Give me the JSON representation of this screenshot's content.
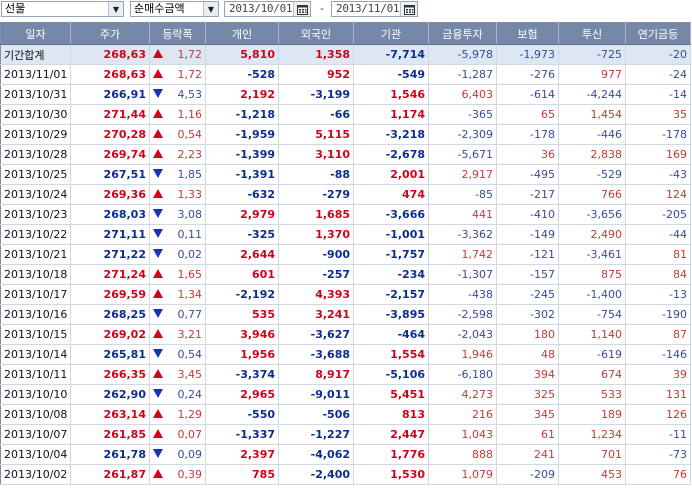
{
  "toolbar": {
    "market_select": "선물",
    "metric_select": "순매수금액",
    "date_from": "2013/10/01",
    "date_separator": "-",
    "date_to": "2013/11/01"
  },
  "colors": {
    "up": "#d0021b",
    "down": "#1a33b5",
    "header_bg": "#7688a8",
    "total_row_bg": "#dde6f3"
  },
  "icons": {
    "dropdown": "chevron-down-icon",
    "calendar": "calendar-icon",
    "up": "triangle-up-icon",
    "down": "triangle-down-icon"
  },
  "table": {
    "columns": [
      "일자",
      "주가",
      "등락폭",
      "개인",
      "외국인",
      "기관",
      "금융투자",
      "보험",
      "투신",
      "연기금등"
    ],
    "rows": [
      {
        "date": "기간합계",
        "price": "268,63",
        "dir": "up",
        "chg": "1,72",
        "ind": "5,810",
        "for": "1,358",
        "inst": "-7,714",
        "fin": "-5,978",
        "ins": "-1,973",
        "trust": "-725",
        "pen": "-20"
      },
      {
        "date": "2013/11/01",
        "price": "268,63",
        "dir": "up",
        "chg": "1,72",
        "ind": "-528",
        "for": "952",
        "inst": "-549",
        "fin": "-1,287",
        "ins": "-276",
        "trust": "977",
        "pen": "-24"
      },
      {
        "date": "2013/10/31",
        "price": "266,91",
        "dir": "down",
        "chg": "4,53",
        "ind": "2,192",
        "for": "-3,199",
        "inst": "1,546",
        "fin": "6,403",
        "ins": "-614",
        "trust": "-4,244",
        "pen": "-14"
      },
      {
        "date": "2013/10/30",
        "price": "271,44",
        "dir": "up",
        "chg": "1,16",
        "ind": "-1,218",
        "for": "-66",
        "inst": "1,174",
        "fin": "-365",
        "ins": "65",
        "trust": "1,454",
        "pen": "35"
      },
      {
        "date": "2013/10/29",
        "price": "270,28",
        "dir": "up",
        "chg": "0,54",
        "ind": "-1,959",
        "for": "5,115",
        "inst": "-3,218",
        "fin": "-2,309",
        "ins": "-178",
        "trust": "-446",
        "pen": "-178"
      },
      {
        "date": "2013/10/28",
        "price": "269,74",
        "dir": "up",
        "chg": "2,23",
        "ind": "-1,399",
        "for": "3,110",
        "inst": "-2,678",
        "fin": "-5,671",
        "ins": "36",
        "trust": "2,838",
        "pen": "169"
      },
      {
        "date": "2013/10/25",
        "price": "267,51",
        "dir": "down",
        "chg": "1,85",
        "ind": "-1,391",
        "for": "-88",
        "inst": "2,001",
        "fin": "2,917",
        "ins": "-495",
        "trust": "-529",
        "pen": "-43"
      },
      {
        "date": "2013/10/24",
        "price": "269,36",
        "dir": "up",
        "chg": "1,33",
        "ind": "-632",
        "for": "-279",
        "inst": "474",
        "fin": "-85",
        "ins": "-217",
        "trust": "766",
        "pen": "124"
      },
      {
        "date": "2013/10/23",
        "price": "268,03",
        "dir": "down",
        "chg": "3,08",
        "ind": "2,979",
        "for": "1,685",
        "inst": "-3,666",
        "fin": "441",
        "ins": "-410",
        "trust": "-3,656",
        "pen": "-205"
      },
      {
        "date": "2013/10/22",
        "price": "271,11",
        "dir": "down",
        "chg": "0,11",
        "ind": "-325",
        "for": "1,370",
        "inst": "-1,001",
        "fin": "-3,362",
        "ins": "-149",
        "trust": "2,490",
        "pen": "-44"
      },
      {
        "date": "2013/10/21",
        "price": "271,22",
        "dir": "down",
        "chg": "0,02",
        "ind": "2,644",
        "for": "-900",
        "inst": "-1,757",
        "fin": "1,742",
        "ins": "-121",
        "trust": "-3,461",
        "pen": "81"
      },
      {
        "date": "2013/10/18",
        "price": "271,24",
        "dir": "up",
        "chg": "1,65",
        "ind": "601",
        "for": "-257",
        "inst": "-234",
        "fin": "-1,307",
        "ins": "-157",
        "trust": "875",
        "pen": "84"
      },
      {
        "date": "2013/10/17",
        "price": "269,59",
        "dir": "up",
        "chg": "1,34",
        "ind": "-2,192",
        "for": "4,393",
        "inst": "-2,157",
        "fin": "-438",
        "ins": "-245",
        "trust": "-1,400",
        "pen": "-13"
      },
      {
        "date": "2013/10/16",
        "price": "268,25",
        "dir": "down",
        "chg": "0,77",
        "ind": "535",
        "for": "3,241",
        "inst": "-3,895",
        "fin": "-2,598",
        "ins": "-302",
        "trust": "-754",
        "pen": "-190"
      },
      {
        "date": "2013/10/15",
        "price": "269,02",
        "dir": "up",
        "chg": "3,21",
        "ind": "3,946",
        "for": "-3,627",
        "inst": "-464",
        "fin": "-2,043",
        "ins": "180",
        "trust": "1,140",
        "pen": "87"
      },
      {
        "date": "2013/10/14",
        "price": "265,81",
        "dir": "down",
        "chg": "0,54",
        "ind": "1,956",
        "for": "-3,688",
        "inst": "1,554",
        "fin": "1,946",
        "ins": "48",
        "trust": "-619",
        "pen": "-146"
      },
      {
        "date": "2013/10/11",
        "price": "266,35",
        "dir": "up",
        "chg": "3,45",
        "ind": "-3,374",
        "for": "8,917",
        "inst": "-5,106",
        "fin": "-6,180",
        "ins": "394",
        "trust": "674",
        "pen": "39"
      },
      {
        "date": "2013/10/10",
        "price": "262,90",
        "dir": "down",
        "chg": "0,24",
        "ind": "2,965",
        "for": "-9,011",
        "inst": "5,451",
        "fin": "4,273",
        "ins": "325",
        "trust": "533",
        "pen": "131"
      },
      {
        "date": "2013/10/08",
        "price": "263,14",
        "dir": "up",
        "chg": "1,29",
        "ind": "-550",
        "for": "-506",
        "inst": "813",
        "fin": "216",
        "ins": "345",
        "trust": "189",
        "pen": "126"
      },
      {
        "date": "2013/10/07",
        "price": "261,85",
        "dir": "up",
        "chg": "0,07",
        "ind": "-1,337",
        "for": "-1,227",
        "inst": "2,447",
        "fin": "1,043",
        "ins": "61",
        "trust": "1,234",
        "pen": "-11"
      },
      {
        "date": "2013/10/04",
        "price": "261,78",
        "dir": "down",
        "chg": "0,09",
        "ind": "2,397",
        "for": "-4,062",
        "inst": "1,776",
        "fin": "888",
        "ins": "241",
        "trust": "701",
        "pen": "-73"
      },
      {
        "date": "2013/10/02",
        "price": "261,87",
        "dir": "up",
        "chg": "0,39",
        "ind": "785",
        "for": "-2,400",
        "inst": "1,530",
        "fin": "1,079",
        "ins": "-209",
        "trust": "453",
        "pen": "76"
      }
    ]
  }
}
